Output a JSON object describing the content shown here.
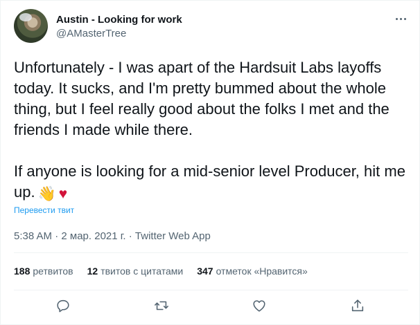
{
  "author": {
    "display_name": "Austin - Looking for work",
    "handle": "@AMasterTree"
  },
  "tweet": {
    "paragraph1": "Unfortunately - I was apart of the Hardsuit Labs layoffs today. It sucks, and I'm pretty bummed about the whole thing, but I feel really good about the folks I met and the friends I made while there.",
    "paragraph2": "If anyone is looking for a mid-senior level Producer, hit me up.",
    "emoji_wave": "👋",
    "emoji_heart": "♥",
    "translate_label": "Перевести твит"
  },
  "meta": {
    "time": "5:38 AM",
    "separator": " · ",
    "date": "2 мар. 2021 г.",
    "app": "Twitter Web App"
  },
  "stats": {
    "retweets_count": "188",
    "retweets_label": "ретвитов",
    "quotes_count": "12",
    "quotes_label": "твитов с цитатами",
    "likes_count": "347",
    "likes_label": "отметок «Нравится»"
  },
  "icons": {
    "more": "more-icon",
    "reply": "reply-icon",
    "retweet": "retweet-icon",
    "like": "heart-icon",
    "share": "share-icon"
  },
  "colors": {
    "text": "#0f1419",
    "secondary": "#536471",
    "link": "#1d9bf0",
    "heart": "#d2133a"
  }
}
